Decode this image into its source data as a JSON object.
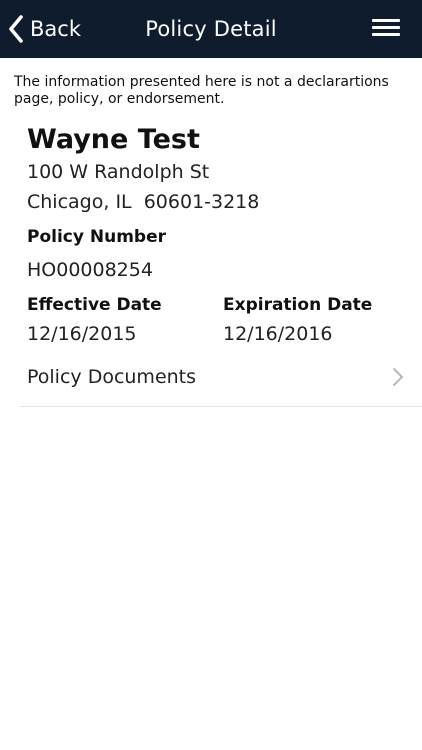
{
  "nav": {
    "back_label": "Back",
    "title": "Policy Detail",
    "background_color": "#0e1c2e"
  },
  "disclaimer": "The information presented here is not a declarartions page, policy, or endorsement.",
  "holder": {
    "name": "Wayne Test",
    "address_line1": "100 W Randolph St",
    "address_line2": "Chicago, IL  60601-3218"
  },
  "policy": {
    "number_label": "Policy Number",
    "number": "HO00008254",
    "effective_label": "Effective Date",
    "effective": "12/16/2015",
    "expiration_label": "Expiration Date",
    "expiration": "12/16/2016"
  },
  "documents": {
    "label": "Policy Documents"
  },
  "icons": {
    "back": "chevron-left-icon",
    "menu": "hamburger-menu-icon",
    "row_disclosure": "chevron-right-icon"
  }
}
